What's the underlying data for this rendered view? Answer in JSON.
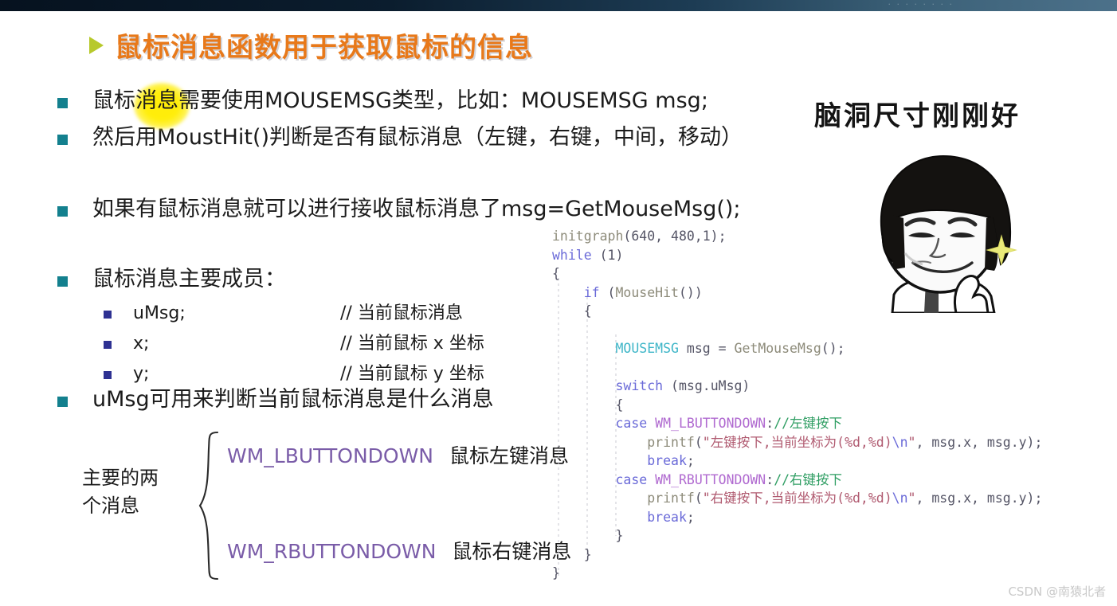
{
  "topbar": {
    "faint_text": "· · · · · · · ·"
  },
  "title": {
    "bullet_icon": "triangle-right-icon",
    "text": "鼠标消息函数用于获取鼠标的信息",
    "color": "#e8791a",
    "triangle_color": "#b7c92b"
  },
  "bullets": {
    "bullet_color": "#13808e",
    "sub_bullet_color": "#2e3192",
    "line1_a": "鼠标",
    "line1_highlight": "消息",
    "line1_b": "需要使用MOUSEMSG类型，比如：MOUSEMSG msg;",
    "line2": "然后用MoustHit()判断是否有鼠标消息（左键，右键，中间，移动）",
    "line3": "如果有鼠标消息就可以进行接收鼠标消息了msg=GetMouseMsg();",
    "line4": "鼠标消息主要成员：",
    "sub": [
      {
        "name": "uMsg;",
        "comment": "// 当前鼠标消息"
      },
      {
        "name": "x;",
        "comment": "// 当前鼠标 x 坐标"
      },
      {
        "name": "y;",
        "comment": "// 当前鼠标 y 坐标"
      }
    ],
    "line5": "uMsg可用来判断当前鼠标消息是什么消息"
  },
  "brace_group": {
    "label_line1": "主要的两",
    "label_line2": "个消息",
    "items": [
      {
        "const": "WM_LBUTTONDOWN",
        "desc": "鼠标左键消息"
      },
      {
        "const": "WM_RBUTTONDOWN",
        "desc": "鼠标右键消息"
      }
    ],
    "const_color": "#7a5ca8"
  },
  "code": {
    "lines": [
      [
        {
          "t": "initgraph",
          "c": "c-fn"
        },
        {
          "t": "(640, 480,1);",
          "c": "c-punc"
        }
      ],
      [
        {
          "t": "while",
          "c": "c-kw"
        },
        {
          "t": " (1)",
          "c": "c-punc"
        }
      ],
      [
        {
          "t": "{",
          "c": "c-punc"
        }
      ],
      [
        {
          "t": "    ",
          "c": "c-punc"
        },
        {
          "t": "if",
          "c": "c-kw"
        },
        {
          "t": " (",
          "c": "c-punc"
        },
        {
          "t": "MouseHit",
          "c": "c-fn"
        },
        {
          "t": "())",
          "c": "c-punc"
        }
      ],
      [
        {
          "t": "    {",
          "c": "c-punc"
        }
      ],
      [
        {
          "t": "",
          "c": "c-punc"
        }
      ],
      [
        {
          "t": "        ",
          "c": "c-punc"
        },
        {
          "t": "MOUSEMSG",
          "c": "c-type"
        },
        {
          "t": " msg = ",
          "c": "c-plain"
        },
        {
          "t": "GetMouseMsg",
          "c": "c-fn"
        },
        {
          "t": "();",
          "c": "c-punc"
        }
      ],
      [
        {
          "t": "",
          "c": "c-punc"
        }
      ],
      [
        {
          "t": "        ",
          "c": "c-punc"
        },
        {
          "t": "switch",
          "c": "c-kw"
        },
        {
          "t": " (msg.uMsg)",
          "c": "c-punc"
        }
      ],
      [
        {
          "t": "        {",
          "c": "c-punc"
        }
      ],
      [
        {
          "t": "        ",
          "c": "c-punc"
        },
        {
          "t": "case",
          "c": "c-kw"
        },
        {
          "t": " ",
          "c": "c-punc"
        },
        {
          "t": "WM_LBUTTONDOWN",
          "c": "c-macro"
        },
        {
          "t": ":",
          "c": "c-punc"
        },
        {
          "t": "//左键按下",
          "c": "c-cmt"
        }
      ],
      [
        {
          "t": "            ",
          "c": "c-punc"
        },
        {
          "t": "printf",
          "c": "c-fn"
        },
        {
          "t": "(",
          "c": "c-punc"
        },
        {
          "t": "\"左键按下,当前坐标为(%d,%d)",
          "c": "c-str"
        },
        {
          "t": "\\n",
          "c": "c-esc"
        },
        {
          "t": "\"",
          "c": "c-str"
        },
        {
          "t": ", msg.x, msg.y);",
          "c": "c-plain"
        }
      ],
      [
        {
          "t": "            ",
          "c": "c-punc"
        },
        {
          "t": "break",
          "c": "c-kw"
        },
        {
          "t": ";",
          "c": "c-punc"
        }
      ],
      [
        {
          "t": "        ",
          "c": "c-punc"
        },
        {
          "t": "case",
          "c": "c-kw"
        },
        {
          "t": " ",
          "c": "c-punc"
        },
        {
          "t": "WM_RBUTTONDOWN",
          "c": "c-macro"
        },
        {
          "t": ":",
          "c": "c-punc"
        },
        {
          "t": "//右键按下",
          "c": "c-cmt"
        }
      ],
      [
        {
          "t": "            ",
          "c": "c-punc"
        },
        {
          "t": "printf",
          "c": "c-fn"
        },
        {
          "t": "(",
          "c": "c-punc"
        },
        {
          "t": "\"右键按下,当前坐标为(%d,%d)",
          "c": "c-str"
        },
        {
          "t": "\\n",
          "c": "c-esc"
        },
        {
          "t": "\"",
          "c": "c-str"
        },
        {
          "t": ", msg.x, msg.y);",
          "c": "c-plain"
        }
      ],
      [
        {
          "t": "            ",
          "c": "c-punc"
        },
        {
          "t": "break",
          "c": "c-kw"
        },
        {
          "t": ";",
          "c": "c-punc"
        }
      ],
      [
        {
          "t": "        }",
          "c": "c-punc"
        }
      ],
      [
        {
          "t": "    }",
          "c": "c-punc"
        }
      ],
      [
        {
          "t": "}",
          "c": "c-punc"
        }
      ]
    ]
  },
  "meme": {
    "handwritten_note": "脑洞尺寸刚刚好",
    "alt": "meme-face-character"
  },
  "watermark": {
    "text": "CSDN @南猿北者"
  }
}
